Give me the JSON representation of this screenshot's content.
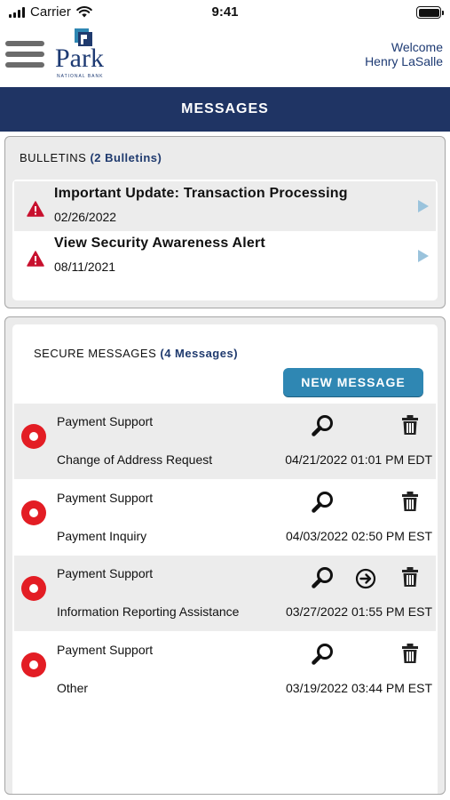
{
  "status_bar": {
    "carrier": "Carrier",
    "time": "9:41"
  },
  "header": {
    "logo_text": "Park",
    "logo_subtext": "NATIONAL BANK",
    "welcome_line": "Welcome",
    "user_name": "Henry LaSalle"
  },
  "page": {
    "title": "MESSAGES"
  },
  "bulletins": {
    "label": "BULLETINS",
    "count_label": "(2 Bulletins)",
    "items": [
      {
        "title": "Important Update: Transaction Processing",
        "date": "02/26/2022",
        "icon": "warning-icon"
      },
      {
        "title": "View Security Awareness Alert",
        "date": "08/11/2021",
        "icon": "warning-icon"
      }
    ]
  },
  "secure_messages": {
    "label": "SECURE MESSAGES",
    "count_label": "(4 Messages)",
    "new_message_label": "NEW MESSAGE",
    "items": [
      {
        "sender": "Payment Support",
        "subject": "Change of Address Request",
        "date": "04/21/2022 01:01 PM EDT",
        "unread": true
      },
      {
        "sender": "Payment Support",
        "subject": "Payment Inquiry",
        "date": "04/03/2022 02:50 PM EST",
        "unread": true
      },
      {
        "sender": "Payment Support",
        "subject": "Information Reporting Assistance",
        "date": "03/27/2022 01:55 PM EST",
        "unread": true,
        "has_forward": true
      },
      {
        "sender": "Payment Support",
        "subject": "Other",
        "date": "03/19/2022 03:44 PM EST",
        "unread": true
      }
    ]
  },
  "colors": {
    "brand_navy": "#1f3464",
    "accent_blue": "#2f87b3",
    "unread_red": "#e31d24",
    "warning_red": "#c8102e"
  }
}
